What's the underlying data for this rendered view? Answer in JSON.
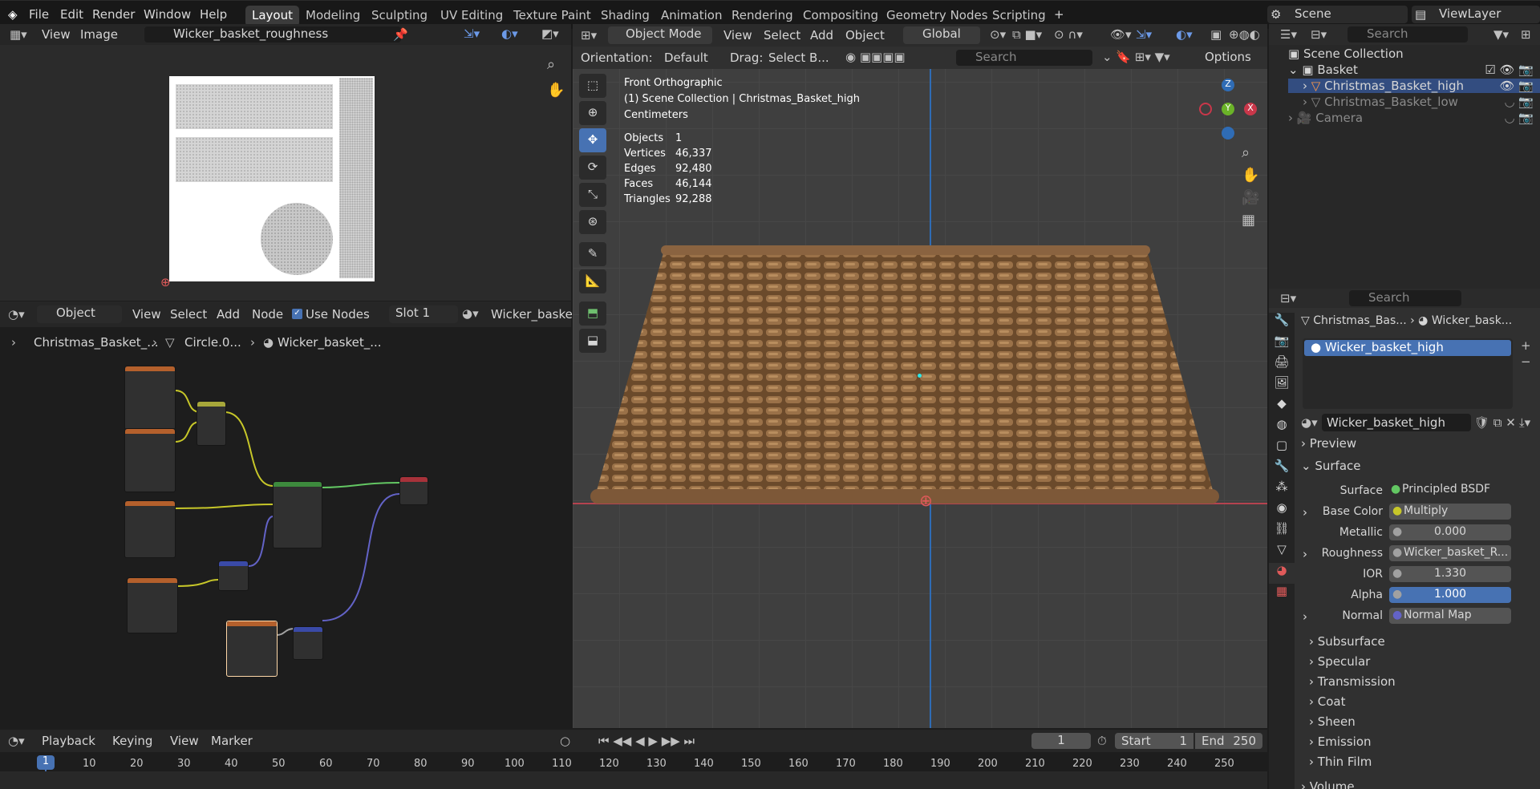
{
  "top": {
    "logo": "blender-logo-icon",
    "menus": [
      "File",
      "Edit",
      "Render",
      "Window",
      "Help"
    ],
    "workspaces": [
      "Layout",
      "Modeling",
      "Sculpting",
      "UV Editing",
      "Texture Paint",
      "Shading",
      "Animation",
      "Rendering",
      "Compositing",
      "Geometry Nodes",
      "Scripting"
    ],
    "add_tab": "+",
    "scene": "Scene",
    "view_layer": "ViewLayer"
  },
  "image_editor": {
    "view": "View",
    "image": "Image",
    "image_name": "Wicker_basket_roughness"
  },
  "node_editor": {
    "mode": "Object",
    "view": "View",
    "select": "Select",
    "add": "Add",
    "node": "Node",
    "use_nodes": "Use Nodes",
    "slot": "Slot 1",
    "material": "Wicker_basket_",
    "breadcrumb": [
      "Christmas_Basket_...",
      "Circle.0...",
      "Wicker_basket_..."
    ]
  },
  "viewport": {
    "mode": "Object Mode",
    "menus": [
      "View",
      "Select",
      "Add",
      "Object"
    ],
    "orientation_label": "Orientation:",
    "orientation": "Default",
    "drag_label": "Drag:",
    "drag": "Select B...",
    "transform": "Global",
    "search_placeholder": "Search",
    "options": "Options",
    "info": {
      "view": "Front Orthographic",
      "collection": "(1) Scene Collection | Christmas_Basket_high",
      "units": "Centimeters"
    },
    "stats": [
      {
        "k": "Objects",
        "v": "1"
      },
      {
        "k": "Vertices",
        "v": "46,337"
      },
      {
        "k": "Edges",
        "v": "92,480"
      },
      {
        "k": "Faces",
        "v": "46,144"
      },
      {
        "k": "Triangles",
        "v": "92,288"
      }
    ],
    "gizmo": {
      "z": "Z",
      "y": "Y",
      "x": "X"
    }
  },
  "outliner": {
    "search_placeholder": "Search",
    "root": "Scene Collection",
    "items": [
      {
        "name": "Basket"
      },
      {
        "name": "Christmas_Basket_high"
      },
      {
        "name": "Christmas_Basket_low"
      },
      {
        "name": "Camera"
      }
    ]
  },
  "properties": {
    "search_placeholder": "Search",
    "breadcrumb": [
      "Christmas_Bas...",
      "Wicker_bask..."
    ],
    "slot_item": "Wicker_basket_high",
    "material_name": "Wicker_basket_high",
    "preview": "Preview",
    "surface_section": "Surface",
    "rows": [
      {
        "label": "Surface",
        "value": "Principled BSDF",
        "dot": "#63c763"
      },
      {
        "label": "Base Color",
        "value": "Multiply",
        "dot": "#c7c729"
      },
      {
        "label": "Metallic",
        "value": "0.000",
        "dot": "#a1a1a1"
      },
      {
        "label": "Roughness",
        "value": "Wicker_basket_R...",
        "dot": "#a1a1a1"
      },
      {
        "label": "IOR",
        "value": "1.330",
        "dot": "#a1a1a1"
      },
      {
        "label": "Alpha",
        "value": "1.000",
        "dot": "#a1a1a1"
      },
      {
        "label": "Normal",
        "value": "Normal Map",
        "dot": "#6363c7"
      }
    ],
    "subsections": [
      "Subsurface",
      "Specular",
      "Transmission",
      "Coat",
      "Sheen",
      "Emission",
      "Thin Film",
      "Volume"
    ]
  },
  "timeline": {
    "menus": [
      "Playback",
      "Keying",
      "View",
      "Marker"
    ],
    "frame": "1",
    "start_label": "Start",
    "start": "1",
    "end_label": "End",
    "end": "250",
    "current": "1",
    "ticks": [
      "10",
      "20",
      "30",
      "40",
      "50",
      "60",
      "70",
      "80",
      "90",
      "100",
      "110",
      "120",
      "130",
      "140",
      "150",
      "160",
      "170",
      "180",
      "190",
      "200",
      "210",
      "220",
      "230",
      "240",
      "250"
    ]
  }
}
